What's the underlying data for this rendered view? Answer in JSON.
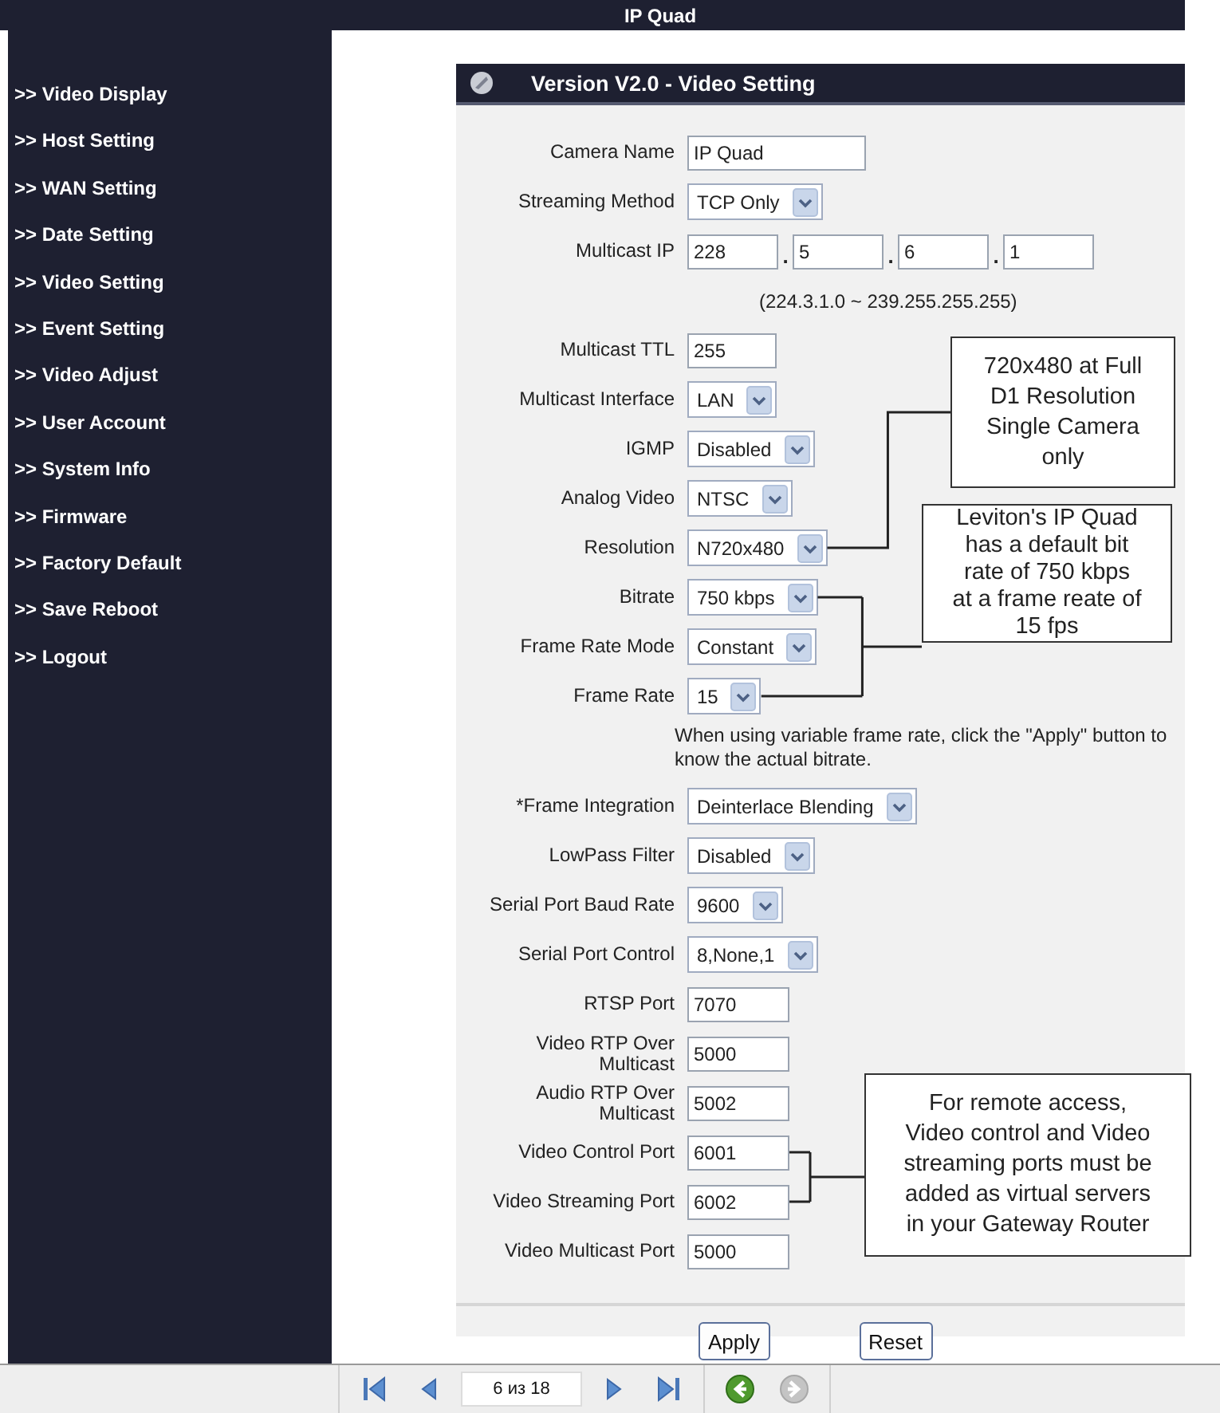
{
  "title": "IP Quad",
  "sidebar": {
    "items": [
      ">> Video Display",
      ">> Host Setting",
      ">> WAN Setting",
      ">> Date Setting",
      ">> Video Setting",
      ">> Event Setting",
      ">> Video Adjust",
      ">> User Account",
      ">> System Info",
      ">> Firmware",
      ">> Factory Default",
      ">> Save Reboot",
      ">> Logout"
    ]
  },
  "panel": {
    "title": "Version V2.0 - Video Setting",
    "rows": [
      {
        "kind": "text",
        "label": "Camera Name",
        "value": "IP Quad"
      },
      {
        "kind": "select",
        "label": "Streaming Method",
        "value": "TCP Only"
      },
      {
        "kind": "ip",
        "label": "Multicast IP",
        "parts": [
          "228",
          "5",
          "6",
          "1"
        ],
        "separators": [
          ".",
          ".",
          "."
        ]
      },
      {
        "kind": "hint",
        "text": "(224.3.1.0 ~ 239.255.255.255)"
      },
      {
        "kind": "text",
        "label": "Multicast TTL",
        "value": "255"
      },
      {
        "kind": "select",
        "label": "Multicast Interface",
        "value": "LAN"
      },
      {
        "kind": "select",
        "label": "IGMP",
        "value": "Disabled"
      },
      {
        "kind": "select",
        "label": "Analog Video",
        "value": "NTSC"
      },
      {
        "kind": "select",
        "label": "Resolution",
        "value": "N720x480"
      },
      {
        "kind": "select",
        "label": "Bitrate",
        "value": "750 kbps"
      },
      {
        "kind": "select",
        "label": "Frame Rate Mode",
        "value": "Constant"
      },
      {
        "kind": "select",
        "label": "Frame Rate",
        "value": "15"
      },
      {
        "kind": "note",
        "text": "When using variable frame rate, click the \"Apply\" button to know the actual bitrate."
      },
      {
        "kind": "select",
        "label": "*Frame Integration",
        "value": "Deinterlace Blending"
      },
      {
        "kind": "select",
        "label": "LowPass Filter",
        "value": "Disabled"
      },
      {
        "kind": "select",
        "label": "Serial Port Baud Rate",
        "value": "9600"
      },
      {
        "kind": "select",
        "label": "Serial Port Control",
        "value": "8,None,1"
      },
      {
        "kind": "text",
        "label": "RTSP Port",
        "value": "7070"
      },
      {
        "kind": "text",
        "label": "Video RTP Over\nMulticast",
        "value": "5000"
      },
      {
        "kind": "text",
        "label": "Audio RTP Over\nMulticast",
        "value": "5002"
      },
      {
        "kind": "text",
        "label": "Video Control Port",
        "value": "6001"
      },
      {
        "kind": "text",
        "label": "Video Streaming Port",
        "value": "6002"
      },
      {
        "kind": "text",
        "label": "Video Multicast Port",
        "value": "5000"
      }
    ],
    "buttons": [
      "Apply",
      "Reset"
    ]
  },
  "callouts": [
    {
      "text": "720x480 at Full\nD1 Resolution\nSingle Camera\nonly"
    },
    {
      "text": "Leviton's IP Quad\nhas a default bit\nrate of 750 kbps\nat a frame reate of\n15 fps"
    },
    {
      "text": "For remote access,\nVideo control and Video\nstreaming ports must be\nadded as virtual servers\nin your Gateway Router"
    }
  ],
  "viewer_toolbar": {
    "page": "6 из 18",
    "nav": [
      {
        "kind": "first"
      },
      {
        "kind": "prev"
      },
      {
        "kind": "next"
      },
      {
        "kind": "last"
      }
    ],
    "history": [
      {
        "kind": "back",
        "disabled": false
      },
      {
        "kind": "forward",
        "disabled": true
      }
    ]
  }
}
